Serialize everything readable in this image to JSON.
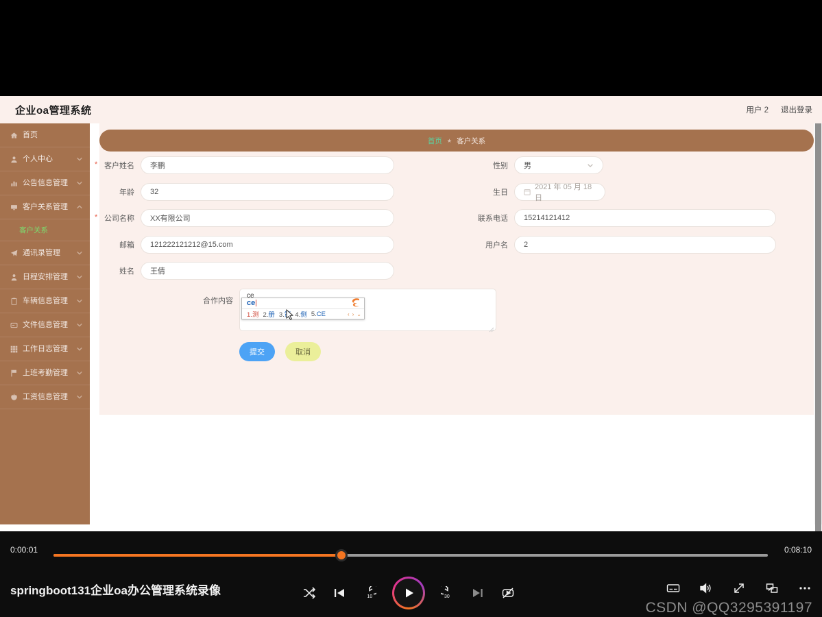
{
  "app": {
    "brand": "企业oa管理系统",
    "header_right": {
      "user": "用户 2",
      "logout": "退出登录"
    },
    "breadcrumb": {
      "home": "首页",
      "separator": "★",
      "current": "客户关系"
    }
  },
  "sidebar": {
    "items": [
      {
        "label": "首页",
        "icon": "home-icon",
        "expandable": false,
        "active": false
      },
      {
        "label": "个人中心",
        "icon": "user-icon",
        "expandable": true,
        "active": false
      },
      {
        "label": "公告信息管理",
        "icon": "chart-icon",
        "expandable": true,
        "active": false
      },
      {
        "label": "客户关系管理",
        "icon": "monitor-icon",
        "expandable": true,
        "active": true
      },
      {
        "label": "通讯录管理",
        "icon": "send-icon",
        "expandable": true,
        "active": false
      },
      {
        "label": "日程安排管理",
        "icon": "person-icon",
        "expandable": true,
        "active": false
      },
      {
        "label": "车辆信息管理",
        "icon": "clipboard-icon",
        "expandable": true,
        "active": false
      },
      {
        "label": "文件信息管理",
        "icon": "folder-icon",
        "expandable": true,
        "active": false
      },
      {
        "label": "工作日志管理",
        "icon": "grid-icon",
        "expandable": true,
        "active": false
      },
      {
        "label": "上班考勤管理",
        "icon": "flag-icon",
        "expandable": true,
        "active": false
      },
      {
        "label": "工资信息管理",
        "icon": "power-icon",
        "expandable": true,
        "active": false
      }
    ],
    "submenu": {
      "parent_index": 3,
      "label": "客户关系"
    }
  },
  "form": {
    "fields": {
      "customer_name": {
        "label": "客户姓名",
        "value": "李鹏",
        "required": true
      },
      "gender": {
        "label": "性别",
        "value": "男",
        "required": false,
        "type": "select"
      },
      "age": {
        "label": "年龄",
        "value": "32",
        "required": false
      },
      "birthday": {
        "label": "生日",
        "value": "2021 年 05 月 18 日",
        "required": false,
        "type": "date"
      },
      "company_name": {
        "label": "公司名称",
        "value": "XX有限公司",
        "required": true
      },
      "phone": {
        "label": "联系电话",
        "value": "15214121412",
        "required": false
      },
      "email": {
        "label": "邮箱",
        "value": "121222121212@15.com",
        "required": false
      },
      "username": {
        "label": "用户名",
        "value": "2",
        "required": false
      },
      "name": {
        "label": "姓名",
        "value": "王倩",
        "required": false
      },
      "content": {
        "label": "合作内容",
        "value": "ce",
        "required": false,
        "type": "textarea"
      }
    },
    "buttons": {
      "submit": "提交",
      "cancel": "取消"
    }
  },
  "ime": {
    "composition": "ce",
    "candidates": [
      {
        "n": "1.",
        "t": "测"
      },
      {
        "n": "2.",
        "t": "册"
      },
      {
        "n": "3.",
        "t": "策"
      },
      {
        "n": "4.",
        "t": "侧"
      },
      {
        "n": "5.",
        "t": "CE"
      }
    ],
    "nav_prev": "‹",
    "nav_next": "›",
    "nav_more": "⌄",
    "toolbar_mode": "中"
  },
  "video": {
    "title": "springboot131企业oa办公管理系统录像",
    "current_time": "0:00:01",
    "duration": "0:08:10",
    "progress_percent": 40,
    "watermark": "CSDN @QQ3295391197",
    "controls": {
      "shuffle": "shuffle-icon",
      "previous": "previous-track-icon",
      "rewind10": "rewind-10-icon",
      "play": "play-icon",
      "forward30": "forward-30-icon",
      "next": "next-track-icon",
      "autoplay_off": "autoplay-off-icon",
      "subtitles": "subtitles-icon",
      "volume": "volume-icon",
      "fullscreen": "fullscreen-icon",
      "pip": "picture-in-picture-icon",
      "more": "more-options-icon"
    }
  },
  "colors": {
    "brand_brown": "#a5724e",
    "panel_bg": "#fbf0ec",
    "accent_green": "#5fcf9e",
    "submit_blue": "#4da3f5",
    "cancel_yellow": "#ebef9a",
    "progress_orange": "#f47521",
    "required_red": "#e8604c"
  }
}
